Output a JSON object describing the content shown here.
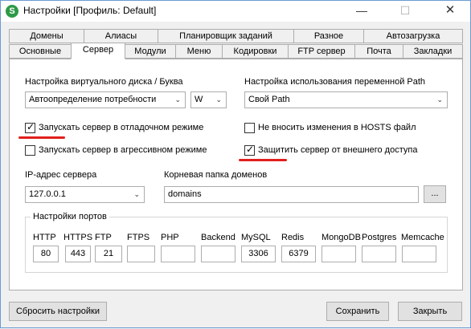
{
  "window": {
    "title": "Настройки [Профиль: Default]",
    "icon_letter": "S",
    "accent_color": "#2e9a47"
  },
  "tabs_row1": [
    "Домены",
    "Алиасы",
    "Планировщик заданий",
    "Разное",
    "Автозагрузка"
  ],
  "tabs_row2": [
    "Основные",
    "Сервер",
    "Модули",
    "Меню",
    "Кодировки",
    "FTP сервер",
    "Почта",
    "Закладки"
  ],
  "active_tab": "Сервер",
  "server": {
    "disk_label": "Настройка виртуального диска / Буква",
    "disk_select": "Автоопределение потребности",
    "drive_letter": "W",
    "path_label": "Настройка использования переменной Path",
    "path_select": "Свой Path",
    "checkboxes": {
      "debug_mode": {
        "label": "Запускать сервер в отладочном режиме",
        "checked": true
      },
      "hosts_file": {
        "label": "Не вносить изменения в HOSTS файл",
        "checked": false
      },
      "aggressive": {
        "label": "Запускать сервер в агрессивном режиме",
        "checked": false
      },
      "protect": {
        "label": "Защитить сервер от внешнего доступа",
        "checked": true
      }
    },
    "ip_label": "IP-адрес сервера",
    "ip_value": "127.0.0.1",
    "root_label": "Корневая папка доменов",
    "root_value": "domains",
    "browse_label": "...",
    "ports_title": "Настройки портов",
    "ports": [
      {
        "name": "HTTP",
        "value": "80"
      },
      {
        "name": "HTTPS",
        "value": "443"
      },
      {
        "name": "FTP",
        "value": "21"
      },
      {
        "name": "FTPS",
        "value": ""
      },
      {
        "name": "PHP",
        "value": ""
      },
      {
        "name": "Backend",
        "value": ""
      },
      {
        "name": "MySQL",
        "value": "3306"
      },
      {
        "name": "Redis",
        "value": "6379"
      },
      {
        "name": "MongoDB",
        "value": ""
      },
      {
        "name": "Postgres",
        "value": ""
      },
      {
        "name": "Memcache",
        "value": ""
      }
    ]
  },
  "footer": {
    "reset_label": "Сбросить настройки",
    "save_label": "Сохранить",
    "close_label": "Закрыть"
  },
  "highlight_color": "#e0201b"
}
